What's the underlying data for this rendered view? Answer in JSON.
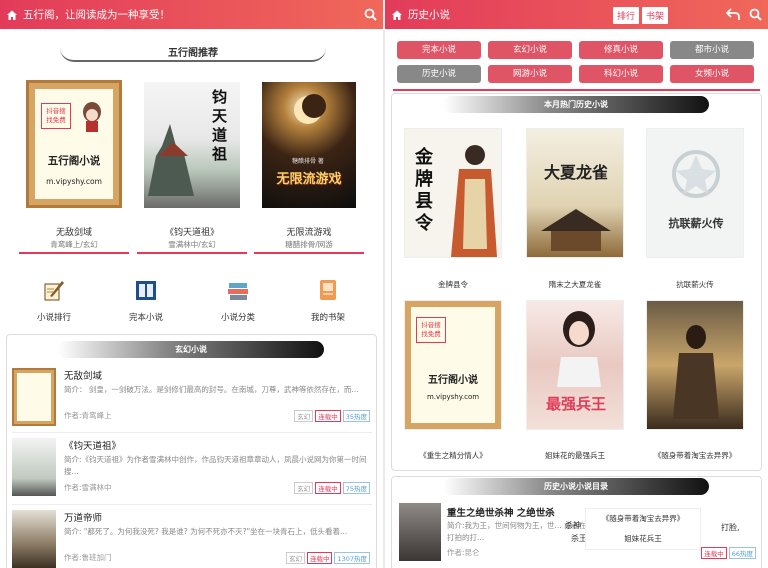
{
  "left": {
    "header_title": "五行阁，让阅读成为一种享受！",
    "rec_title": "五行阁推荐",
    "books": [
      {
        "name": "无敌剑域",
        "meta": "青鸾峰上/玄幻"
      },
      {
        "name": "《钧天道祖》",
        "meta": "雪满林中/玄幻"
      },
      {
        "name": "无限流游戏",
        "meta": "糖醋排骨/网游"
      }
    ],
    "cover_texts": {
      "logo_top": "抖音搜\n找免费",
      "logo_main": "五行阁小说",
      "logo_url": "m.vipyshy.com",
      "book2_title": "钧天道祖",
      "book3_title": "无限流游戏",
      "book3_sub": "糖醋排骨 著"
    },
    "nav": [
      {
        "label": "小说排行",
        "icon": "quill-icon"
      },
      {
        "label": "完本小说",
        "icon": "book-open-icon"
      },
      {
        "label": "小说分类",
        "icon": "books-stack-icon"
      },
      {
        "label": "我的书架",
        "icon": "bookshelf-icon"
      }
    ],
    "section_title": "玄幻小说",
    "list": [
      {
        "title": "无敌剑域",
        "desc": "简介： 剑皇，一剑破万法。是剑修们最高的封号。在南城，刀尊，武神等依然存在，而...",
        "author": "作者:青鸾峰上",
        "tags": [
          "玄幻",
          "连载中",
          "35热度"
        ]
      },
      {
        "title": "《钧天道祖》",
        "desc": "简介:《钧天道祖》为作者雪满林中创作，作品钧天道祖章章动人，凤晨小说网为你第一时间搜...",
        "author": "作者:雪满林中",
        "tags": [
          "玄幻",
          "连载中",
          "75热度"
        ]
      },
      {
        "title": "万道帝师",
        "desc": "简介: \"都死了。为何我没死? 我是谁? 为何不死亦不灭?\"坐在一块青石上，低头看着...",
        "author": "作者:鲁班加门",
        "tags": [
          "玄幻",
          "连载中",
          "1307热度"
        ]
      }
    ]
  },
  "right": {
    "header_title": "历史小说",
    "header_tabs": [
      "排行",
      "书架"
    ],
    "categories": [
      {
        "label": "完本小说",
        "color": "red"
      },
      {
        "label": "玄幻小说",
        "color": "red"
      },
      {
        "label": "修真小说",
        "color": "red"
      },
      {
        "label": "都市小说",
        "color": "gray"
      },
      {
        "label": "历史小说",
        "color": "gray"
      },
      {
        "label": "网游小说",
        "color": "red"
      },
      {
        "label": "科幻小说",
        "color": "red"
      },
      {
        "label": "女频小说",
        "color": "red"
      }
    ],
    "hot_title": "本月热门历史小说",
    "grid": [
      {
        "name": "金牌县令",
        "cover_text": "金牌县令"
      },
      {
        "name": "隋末之大夏龙雀",
        "cover_text": "大夏龙雀"
      },
      {
        "name": "抗联薪火传",
        "cover_text": "抗联薪火传"
      },
      {
        "name": "《重生之精分情人》",
        "cover_text": ""
      },
      {
        "name": "姐妹花的最强兵王",
        "cover_text": "最强兵王"
      },
      {
        "name": "《随身带着淘宝去异界》",
        "cover_text": ""
      }
    ],
    "catalog_title": "历史小说小说目录",
    "catalog_item": {
      "title": "重生之绝世杀神 之绝世杀",
      "desc": "简介:我为王，世间何物为王，世... 或者在刚道打拍的晒打拍打拍的打...",
      "author": "作者:昆仑",
      "tags": [
        "连载中",
        "66热度"
      ]
    },
    "popup_items": [
      "《随身带着淘宝去异界》",
      "姐妹花兵王"
    ],
    "overlay_words": [
      "杀神",
      "杀王",
      "打脸,"
    ]
  },
  "colors": {
    "accent": "#e23b5a",
    "accent2": "#f0685a",
    "gray": "#888888"
  }
}
